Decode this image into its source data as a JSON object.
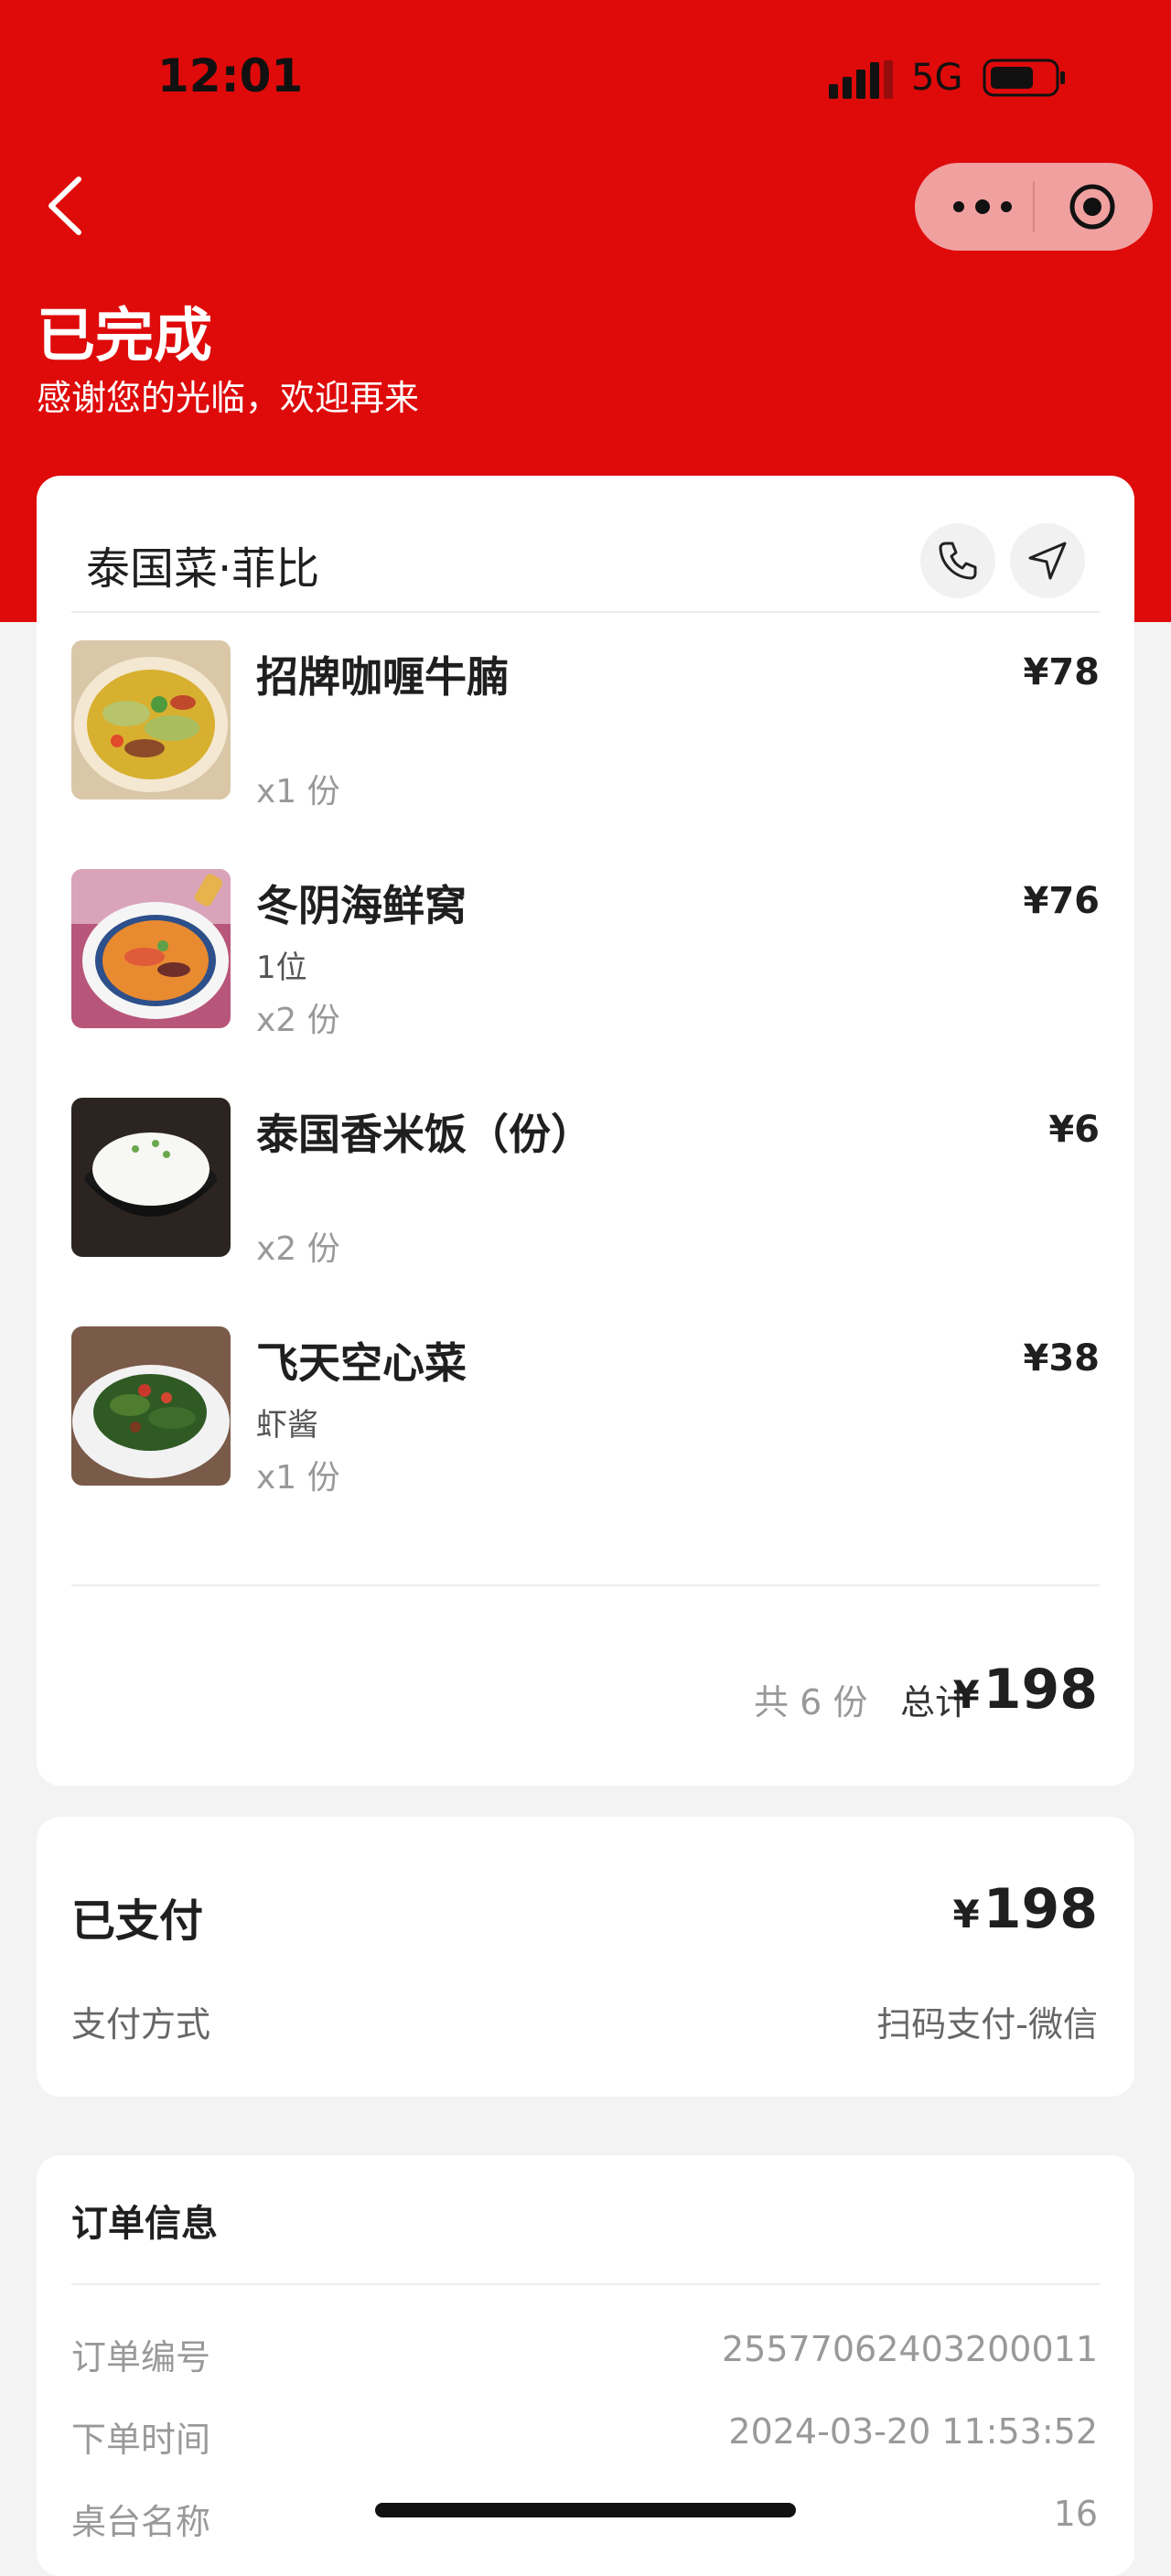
{
  "status_bar": {
    "time": "12:01",
    "network": "5G"
  },
  "header": {
    "status_title": "已完成",
    "status_subtitle": "感谢您的光临，欢迎再来",
    "header_color": "#df0a0a"
  },
  "shop": {
    "name": "泰国菜·菲比",
    "icons": [
      "phone-icon",
      "navigate-icon"
    ]
  },
  "items": [
    {
      "name": "招牌咖喱牛腩",
      "price": "¥78",
      "spec": "",
      "qty": "x1 份"
    },
    {
      "name": "冬阴海鲜窝",
      "price": "¥76",
      "spec": "1位",
      "qty": "x2 份"
    },
    {
      "name": "泰国香米饭（份）",
      "price": "¥6",
      "spec": "",
      "qty": "x2 份"
    },
    {
      "name": "飞天空心菜",
      "price": "¥38",
      "spec": "虾酱",
      "qty": "x1 份"
    }
  ],
  "summary": {
    "count_text": "共 6 份",
    "total_label": "总计",
    "currency": "¥",
    "total_amount": "198"
  },
  "payment": {
    "paid_label": "已支付",
    "currency": "¥",
    "amount": "198",
    "method_label": "支付方式",
    "method_value": "扫码支付-微信"
  },
  "order_info": {
    "title": "订单信息",
    "rows": [
      {
        "label": "订单编号",
        "value": "25577062403200011"
      },
      {
        "label": "下单时间",
        "value": "2024-03-20 11:53:52"
      },
      {
        "label": "桌台名称",
        "value": "16"
      }
    ]
  }
}
